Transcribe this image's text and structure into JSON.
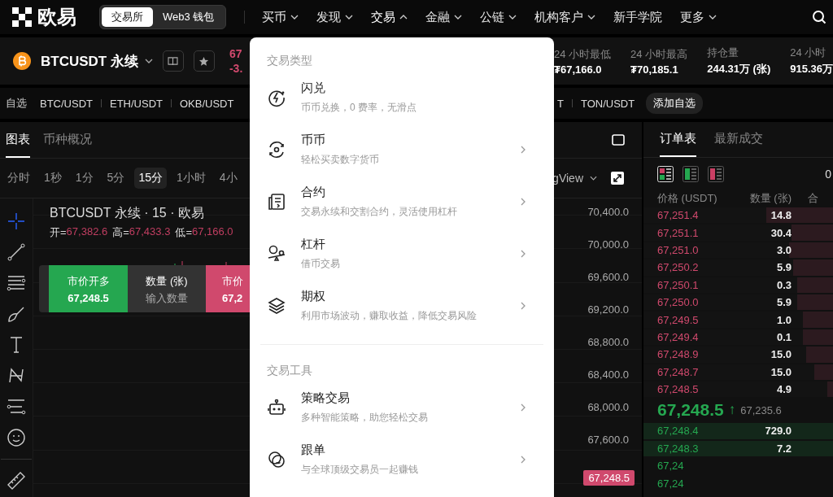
{
  "nav": {
    "logo": "欧易",
    "switch": [
      {
        "label": "交易所",
        "selected": true
      },
      {
        "label": "Web3 钱包",
        "selected": false
      }
    ],
    "items": [
      {
        "label": "买币",
        "has_menu": true,
        "expanded": false
      },
      {
        "label": "发现",
        "has_menu": true,
        "expanded": false
      },
      {
        "label": "交易",
        "has_menu": true,
        "expanded": true
      },
      {
        "label": "金融",
        "has_menu": true,
        "expanded": false
      },
      {
        "label": "公链",
        "has_menu": true,
        "expanded": false
      },
      {
        "label": "机构客户",
        "has_menu": true,
        "expanded": false
      },
      {
        "label": "新手学院",
        "has_menu": false,
        "expanded": false
      },
      {
        "label": "更多",
        "has_menu": true,
        "expanded": false
      }
    ]
  },
  "ticker": {
    "symbol": "BTCUSDT 永续",
    "price": "67",
    "change": "-3.",
    "stats": [
      {
        "label": "24 小时最低",
        "value": "₮67,166.0"
      },
      {
        "label": "24 小时最高",
        "value": "₮70,185.1"
      },
      {
        "label": "持仓量",
        "value": "244.31万 (张)"
      },
      {
        "label": "24 小时",
        "value": "915.36万"
      }
    ]
  },
  "favorites": {
    "label": "自选",
    "pairs": [
      "BTC/USDT",
      "ETH/USDT",
      "OKB/USDT"
    ],
    "pairs_right": [
      "T",
      "TON/USDT"
    ],
    "add": "添加自选"
  },
  "chart_panel": {
    "tabs": [
      {
        "label": "图表",
        "selected": true
      },
      {
        "label": "币种概况",
        "selected": false
      }
    ],
    "timeframes": [
      {
        "label": "分时",
        "selected": false
      },
      {
        "label": "1秒",
        "selected": false
      },
      {
        "label": "1分",
        "selected": false
      },
      {
        "label": "5分",
        "selected": false
      },
      {
        "label": "15分",
        "selected": true
      },
      {
        "label": "1小时",
        "selected": false
      },
      {
        "label": "4小",
        "selected": false
      }
    ],
    "source": "gView",
    "title": "BTCUSDT 永续 · 15 · 欧易",
    "ohlc": [
      {
        "label": "开=",
        "value": "67,382.6"
      },
      {
        "label": "高=",
        "value": "67,433.3"
      },
      {
        "label": "低=",
        "value": "67,166.0"
      }
    ],
    "trade_bar": {
      "buy_label": "市价开多",
      "buy_price": "67,248.5",
      "qty_label": "数量 (张)",
      "qty_placeholder": "输入数量",
      "sell_label": "市价",
      "sell_price": "67,2"
    },
    "price_axis": [
      "70,400.0",
      "70,000.0",
      "69,600.0",
      "69,200.0",
      "68,800.0",
      "68,400.0",
      "68,000.0",
      "67,600.0"
    ],
    "last_price": "67,248.5"
  },
  "order_book": {
    "tabs": [
      {
        "label": "订单表",
        "selected": true
      },
      {
        "label": "最新成交",
        "selected": false
      }
    ],
    "precision": "0",
    "columns": [
      "价格 (USDT)",
      "数量 (张)",
      "合"
    ],
    "asks": [
      {
        "price": "67,251.4",
        "qty": "14.8",
        "level": 0.35
      },
      {
        "price": "67,251.1",
        "qty": "30.4",
        "level": 0.22
      },
      {
        "price": "67,251.0",
        "qty": "3.0",
        "level": 0.23
      },
      {
        "price": "67,250.2",
        "qty": "5.9",
        "level": 0.21
      },
      {
        "price": "67,250.1",
        "qty": "0.3",
        "level": 0.19
      },
      {
        "price": "67,250.0",
        "qty": "5.9",
        "level": 0.19
      },
      {
        "price": "67,249.5",
        "qty": "1.0",
        "level": 0.16
      },
      {
        "price": "67,249.4",
        "qty": "0.1",
        "level": 0.16
      },
      {
        "price": "67,248.9",
        "qty": "15.0",
        "level": 0.14
      },
      {
        "price": "67,248.7",
        "qty": "15.0",
        "level": 0.1
      },
      {
        "price": "67,248.5",
        "qty": "4.9",
        "level": 0.03
      }
    ],
    "last": {
      "price": "67,248.5",
      "arrow": "↑",
      "mark": "67,235.6"
    },
    "bids": [
      {
        "price": "67,248.4",
        "qty": "729.0",
        "level": 1
      },
      {
        "price": "67,248.3",
        "qty": "7.2",
        "level": 1
      },
      {
        "price": "67,24"
      },
      {
        "price": "67,24"
      }
    ]
  },
  "menu": {
    "sections": [
      {
        "title": "交易类型",
        "items": [
          {
            "title": "闪兑",
            "desc": "币币兑换，0 费率，无滑点",
            "chevron": false
          },
          {
            "title": "币币",
            "desc": "轻松买卖数字货币",
            "chevron": true
          },
          {
            "title": "合约",
            "desc": "交易永续和交割合约，灵活使用杠杆",
            "chevron": true
          },
          {
            "title": "杠杆",
            "desc": "借币交易",
            "chevron": true
          },
          {
            "title": "期权",
            "desc": "利用市场波动，赚取收益，降低交易风险",
            "chevron": true
          }
        ]
      },
      {
        "title": "交易工具",
        "items": [
          {
            "title": "策略交易",
            "desc": "多种智能策略，助您轻松交易",
            "chevron": true
          },
          {
            "title": "跟单",
            "desc": "与全球顶级交易员一起赚钱",
            "chevron": true
          }
        ]
      }
    ]
  }
}
